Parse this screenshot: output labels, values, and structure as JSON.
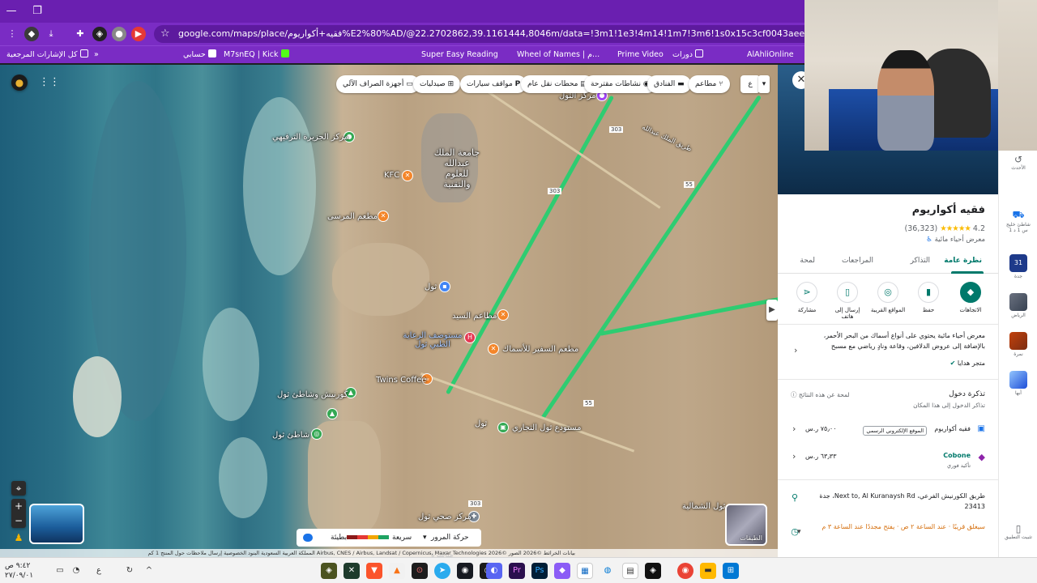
{
  "browser": {
    "url": "google.com/maps/place/فقيه+أكواريوم%E2%80%AD/@22.2702862,39.1161444,8046m/data=!3m1!1e3!4m14!1m7!3m6!1s0x15c3cf0043aee36f:0xdc049c1049a6931a!2zZ3ZiiDYp9mE2LI",
    "bookmarks": [
      "كل الإشارات المرجعية",
      "حسابي",
      "M7snEQ | Kick",
      "Super Easy Reading",
      "Wheel of Names | م...",
      "Prime Video",
      "دورات",
      "AlAhliOnline"
    ]
  },
  "map": {
    "category_chips": [
      "مطاعم",
      "الفنادق",
      "نشاطات مقترحة",
      "محطات نقل عام",
      "مواقف سيارات",
      "صيدليات",
      "أجهزة الصراف الآلي"
    ],
    "search_letter": "ع",
    "places": [
      {
        "label": "مركز الجزيرة الترفيهي"
      },
      {
        "label": "جامعة الملك عبدالله للعلوم والتقنية"
      },
      {
        "label": "KFC"
      },
      {
        "label": "مطعم المرسى"
      },
      {
        "label": "ثول"
      },
      {
        "label": "مطاعم السيد"
      },
      {
        "label": "مستوصف الرعاية الطبي ثول"
      },
      {
        "label": "مطعم السفير للأسماك"
      },
      {
        "label": "Twins Coffee"
      },
      {
        "label": "كورنيش وشاطئ ثول"
      },
      {
        "label": "شاطئ ثول"
      },
      {
        "label": "مستودع ثول التجاري"
      },
      {
        "label": "ثول"
      },
      {
        "label": "مركز صحي ثول"
      },
      {
        "label": "ثول الشمالية"
      },
      {
        "label": "مركز الثول"
      },
      {
        "label": "طريق الملك عبدالله"
      }
    ],
    "road_numbers": [
      "303",
      "55",
      "303",
      "55",
      "303"
    ],
    "traffic": {
      "live": "حركة المرور مباشرة",
      "fast": "سريعة",
      "slow": "بطيئة"
    },
    "layers_label": "الطبقات",
    "footer": "بيانات الخرائط ©2026 الصور ©2026 Airbus, CNES / Airbus, Landsat / Copernicus, Maxar Technologies  المملكة العربية السعودية  البنود  الخصوصية  إرسال ملاحظات حول المنتج  1 كم"
  },
  "panel": {
    "title": "فقيه أكواريوم",
    "rating": "4.2",
    "stars": "★★★★★",
    "reviews": "(36,323)",
    "category": "معرض أحياء مائية",
    "tabs": [
      "نظرة عامة",
      "التذاكر",
      "المراجعات",
      "لمحة"
    ],
    "actions": [
      "الاتجاهات",
      "حفظ",
      "المواقع القريبة",
      "إرسال إلى هاتف",
      "مشاركة"
    ],
    "description": "معرض أحياء مائية يحتوي على أنواع أسماك من البحر الأحمر، بالإضافة إلى عروض الدلافين، وقاعة ونادٍ رياضي مع مسبح",
    "gift_shop": "متجر هدايا",
    "tickets_title": "تذكرة دخول",
    "tickets_sub": "تذاكر الدخول إلى هذا المكان",
    "tickets_about": "لمحة عن هذه النتائج",
    "offers": [
      {
        "seller": "فقيه أكواريوم",
        "badge": "الموقع الإلكتروني الرسمي",
        "price": "٧٥٫٠٠ ر.س"
      },
      {
        "seller": "Cobone",
        "badge": "تأكيد فوري",
        "price": "٦٣٫٣٣ ر.س"
      }
    ],
    "address": "طريق الكورنيش الفرعي، Next to, Al Kuranaysh Rd، جدة 23413",
    "hours": "سيغلق قريبًا · عند الساعة ٢ ص · يفتح مجددًا عند الساعة ٣ م"
  },
  "sidebar": {
    "items": [
      "الأحدث",
      "شاطئ خليج",
      "1 س 1 د",
      "جدة",
      "الرياض",
      "نمرة",
      "أبها",
      "تثبيت التطبيق"
    ]
  },
  "taskbar": {
    "time": "٩:٤٢ ص",
    "date": "٢٧/٠٩/٠١"
  }
}
